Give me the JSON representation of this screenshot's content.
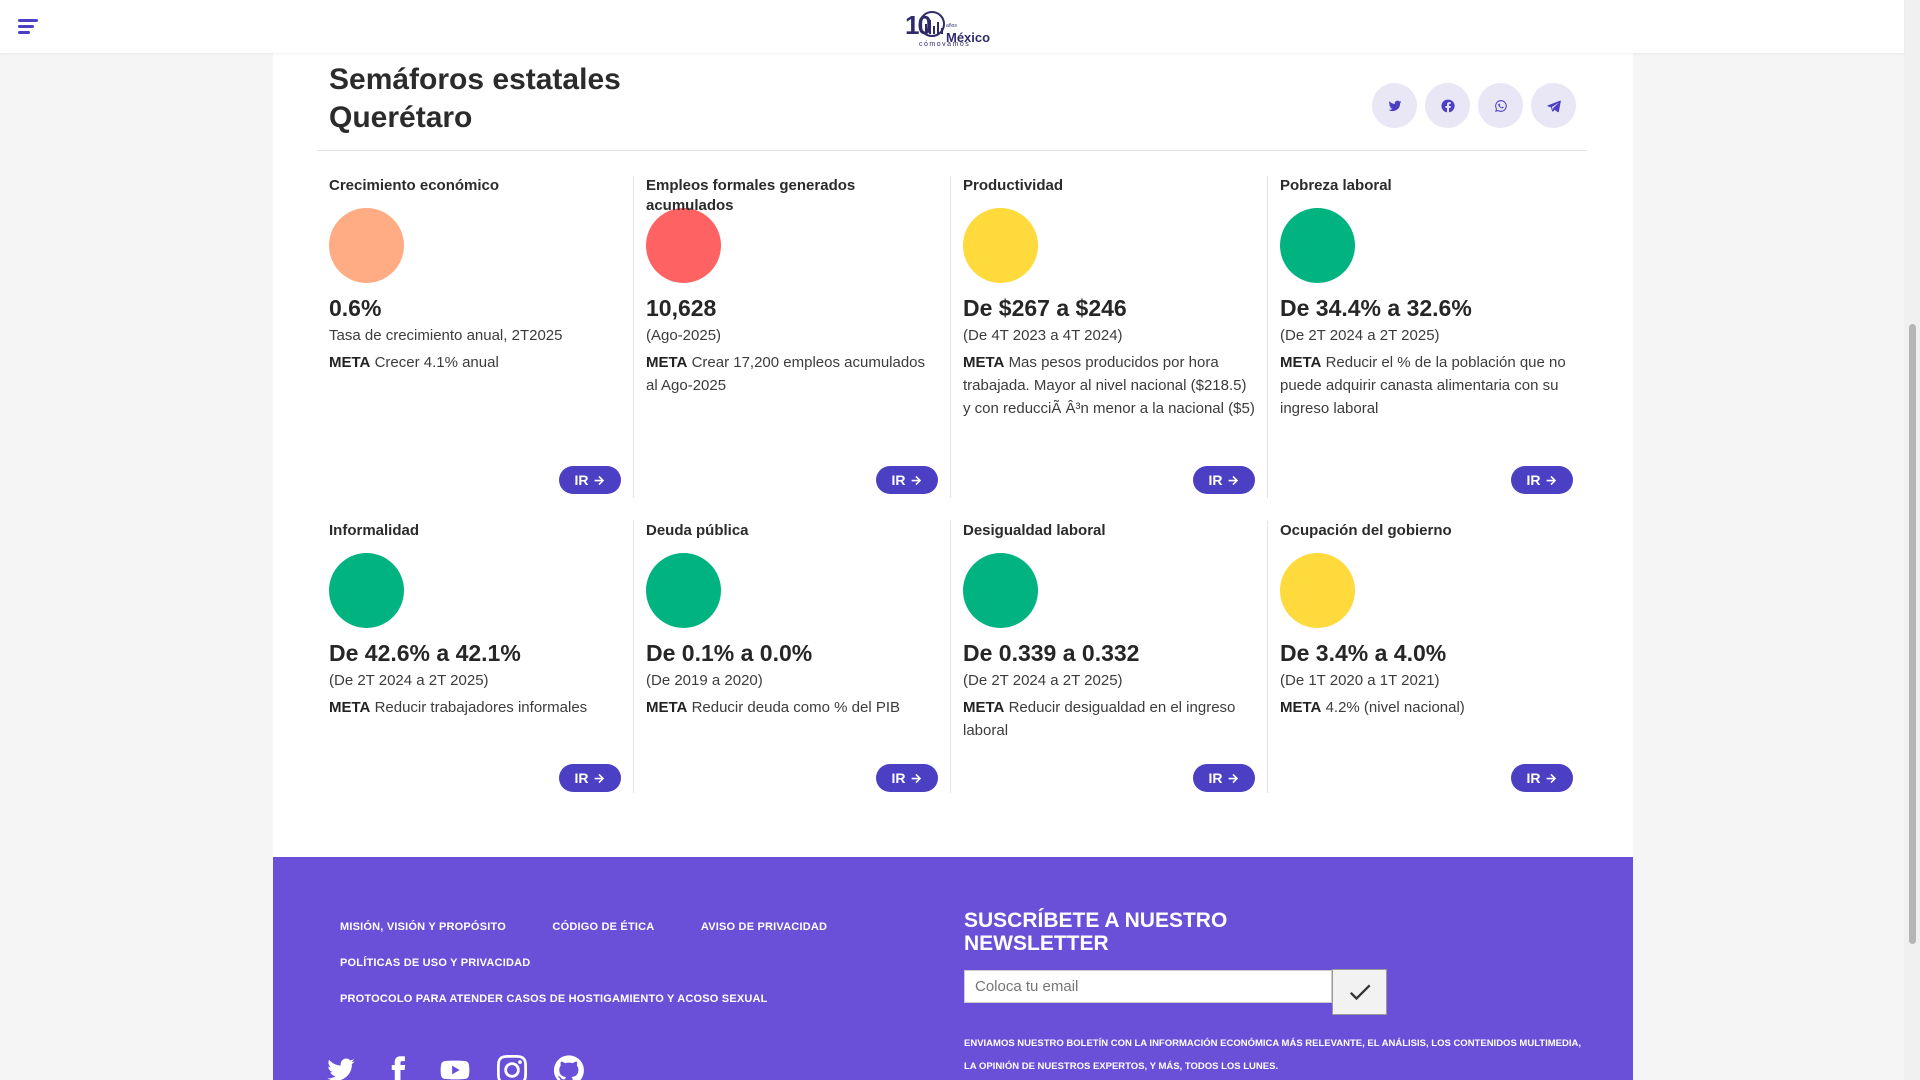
{
  "header": {
    "logo": {
      "number": "10",
      "brand": "México",
      "sub": "cómovamos",
      "anios": "años"
    }
  },
  "page": {
    "title_line1": "Semáforos estatales",
    "title_line2": "Querétaro",
    "share_icons": [
      "twitter-icon",
      "facebook-icon",
      "whatsapp-icon",
      "telegram-icon"
    ]
  },
  "indicators": [
    {
      "label": "Crecimiento económico",
      "color": "#ffab84",
      "value": "0.6%",
      "period": "Tasa de crecimiento anual, 2T2025",
      "meta_label": "META",
      "meta_text": "Crecer 4.1% anual",
      "button": "IR"
    },
    {
      "label": "Empleos formales generados acumulados",
      "color": "#ff6262",
      "value": "10,628",
      "period": "(Ago-2025)",
      "meta_label": "META",
      "meta_text": "Crear 17,200 empleos acumulados al Ago-2025",
      "button": "IR"
    },
    {
      "label": "Productividad",
      "color": "#ffda3c",
      "value": "De $267 a $246",
      "period": "(De 4T 2023 a 4T 2024)",
      "meta_label": "META",
      "meta_text": "Mas pesos producidos por hora trabajada. Mayor al nivel nacional ($218.5) y con reducciÃ Â³n menor a la nacional ($5)",
      "button": "IR"
    },
    {
      "label": "Pobreza laboral",
      "color": "#00b381",
      "value": "De 34.4% a 32.6%",
      "period": "(De 2T 2024 a 2T 2025)",
      "meta_label": "META",
      "meta_text": "Reducir el % de la población que no puede adquirir canasta alimentaria con su ingreso laboral",
      "button": "IR"
    },
    {
      "label": "Informalidad",
      "color": "#00b381",
      "value": "De 42.6% a 42.1%",
      "period": "(De 2T 2024 a 2T 2025)",
      "meta_label": "META",
      "meta_text": "Reducir trabajadores informales",
      "button": "IR"
    },
    {
      "label": "Deuda pública",
      "color": "#00b381",
      "value": "De 0.1% a 0.0%",
      "period": "(De 2019 a 2020)",
      "meta_label": "META",
      "meta_text": "Reducir deuda como % del PIB",
      "button": "IR"
    },
    {
      "label": "Desigualdad laboral",
      "color": "#00b381",
      "value": "De 0.339 a 0.332",
      "period": "(De 2T 2024 a 2T 2025)",
      "meta_label": "META",
      "meta_text": "Reducir desigualdad en el ingreso laboral",
      "button": "IR"
    },
    {
      "label": "Ocupación del gobierno",
      "color": "#ffda3c",
      "value": "De 3.4% a 4.0%",
      "period": "(De 1T 2020 a 1T 2021)",
      "meta_label": "META",
      "meta_text": "4.2% (nivel nacional)",
      "button": "IR"
    }
  ],
  "footer": {
    "links": [
      "MISIÓN, VISIÓN Y PROPÓSITO",
      "CÓDIGO DE ÉTICA",
      "AVISO DE PRIVACIDAD",
      "POLÍTICAS DE USO Y PRIVACIDAD",
      "PROTOCOLO PARA ATENDER CASOS DE HOSTIGAMIENTO Y ACOSO SEXUAL"
    ],
    "social_icons": [
      "twitter-icon",
      "facebook-icon",
      "youtube-icon",
      "instagram-icon",
      "github-icon"
    ],
    "newsletter": {
      "title": "SUSCRÍBETE A NUESTRO NEWSLETTER",
      "placeholder": "Coloca tu email",
      "description": "ENVIAMOS NUESTRO BOLETÍN CON LA INFORMACIÓN ECONÓMICA MÁS RELEVANTE, EL ANÁLISIS, LOS CONTENIDOS MULTIMEDIA, LA OPINIÓN DE NUESTROS EXPERTOS, Y MÁS, TODOS LOS LUNES."
    }
  },
  "colors": {
    "accent": "#4b3fc4",
    "footer": "#6a4fd8",
    "green": "#00b381",
    "yellow": "#ffda3c",
    "red": "#ff6262",
    "orange": "#ffab84"
  }
}
